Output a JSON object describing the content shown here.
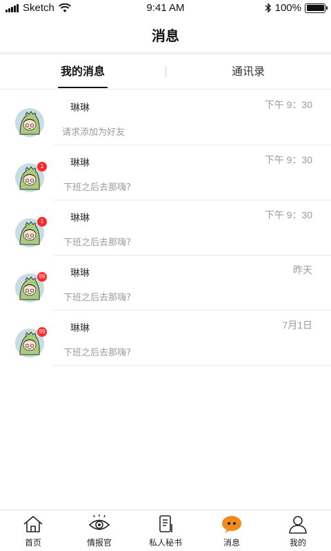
{
  "status_bar": {
    "carrier": "Sketch",
    "time": "9:41 AM",
    "battery": "100%"
  },
  "header": {
    "title": "消息"
  },
  "tabs": [
    {
      "label": "我的消息",
      "active": true
    },
    {
      "label": "通讯录",
      "active": false
    }
  ],
  "messages": [
    {
      "name": "琳琳",
      "time": "下午 9：30",
      "preview": "请求添加为好友",
      "badge": ""
    },
    {
      "name": "琳琳",
      "time": "下午 9：30",
      "preview": "下班之后去那嗨?",
      "badge": "1"
    },
    {
      "name": "琳琳",
      "time": "下午 9：30",
      "preview": "下班之后去那嗨?",
      "badge": "1"
    },
    {
      "name": "琳琳",
      "time": "昨天",
      "preview": "下班之后去那嗨?",
      "badge": "99"
    },
    {
      "name": "琳琳",
      "time": "7月1日",
      "preview": "下班之后去那嗨?",
      "badge": "99"
    }
  ],
  "bottom_nav": [
    {
      "label": "首页",
      "icon": "home-icon"
    },
    {
      "label": "情报官",
      "icon": "eye-icon"
    },
    {
      "label": "私人秘书",
      "icon": "notebook-icon"
    },
    {
      "label": "消息",
      "icon": "chat-bubble-icon",
      "active": true
    },
    {
      "label": "我的",
      "icon": "person-icon"
    }
  ],
  "colors": {
    "accent": "#f08a1c",
    "badge": "#ff2a2a",
    "muted_text": "#9a9a9a"
  }
}
